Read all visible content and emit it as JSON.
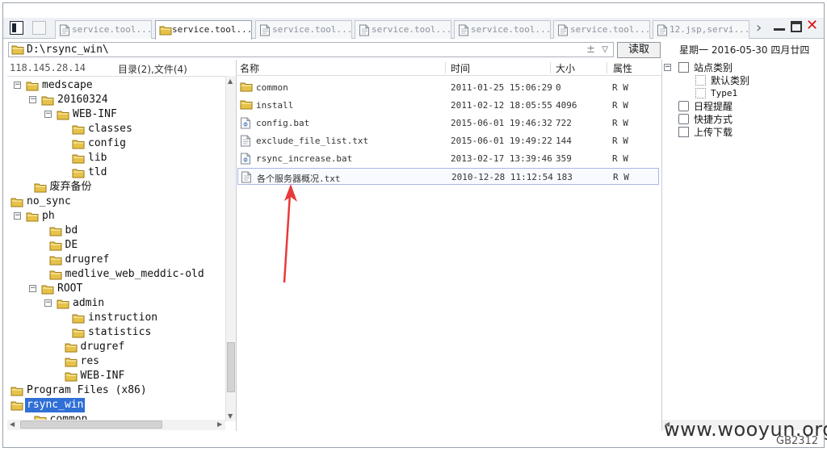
{
  "tabs": [
    {
      "label": "service.tool...",
      "active": false,
      "icon": "file-icon"
    },
    {
      "label": "service.tool...",
      "active": true,
      "icon": "folder-icon"
    },
    {
      "label": "service.tool...",
      "active": false,
      "icon": "file-icon"
    },
    {
      "label": "service.tool...",
      "active": false,
      "icon": "file-icon"
    },
    {
      "label": "service.tool...",
      "active": false,
      "icon": "file-icon"
    },
    {
      "label": "service.tool...",
      "active": false,
      "icon": "file-icon"
    },
    {
      "label": "12.jsp,servi...",
      "active": false,
      "icon": "file-icon"
    }
  ],
  "window_controls": {
    "close": "✕"
  },
  "address": {
    "path": "D:\\rsync_win\\",
    "plusminus": "±",
    "dropdown": "▽"
  },
  "read_button": "读取",
  "date": "星期一  2016-05-30  四月廿四",
  "left_header": {
    "ip": "118.145.28.14",
    "counts": "目录(2),文件(4)"
  },
  "tree": [
    {
      "label": "medscape",
      "toggle": "−",
      "depth": 0
    },
    {
      "label": "20160324",
      "toggle": "−",
      "depth": 1
    },
    {
      "label": "WEB-INF",
      "toggle": "−",
      "depth": 2
    },
    {
      "label": "classes",
      "toggle": "",
      "depth": 3
    },
    {
      "label": "config",
      "toggle": "",
      "depth": 3
    },
    {
      "label": "lib",
      "toggle": "",
      "depth": 3
    },
    {
      "label": "tld",
      "toggle": "",
      "depth": 3
    },
    {
      "label": "废弃备份",
      "toggle": "",
      "depth": 0.5
    },
    {
      "label": "no_sync",
      "toggle": "",
      "depth": -1
    },
    {
      "label": "ph",
      "toggle": "−",
      "depth": 0
    },
    {
      "label": "bd",
      "toggle": "",
      "depth": 1.5
    },
    {
      "label": "DE",
      "toggle": "",
      "depth": 1.5
    },
    {
      "label": "drugref",
      "toggle": "",
      "depth": 1.5
    },
    {
      "label": "medlive_web_meddic-old",
      "toggle": "",
      "depth": 1.5
    },
    {
      "label": "ROOT",
      "toggle": "−",
      "depth": 1
    },
    {
      "label": "admin",
      "toggle": "−",
      "depth": 2
    },
    {
      "label": "instruction",
      "toggle": "",
      "depth": 3
    },
    {
      "label": "statistics",
      "toggle": "",
      "depth": 3
    },
    {
      "label": "drugref",
      "toggle": "",
      "depth": 2.5
    },
    {
      "label": "res",
      "toggle": "",
      "depth": 2.5
    },
    {
      "label": "WEB-INF",
      "toggle": "",
      "depth": 2.5
    },
    {
      "label": "Program Files (x86)",
      "toggle": "",
      "depth": -1
    },
    {
      "label": "rsync_win",
      "toggle": "",
      "depth": -1,
      "selected": true
    },
    {
      "label": "common",
      "toggle": "",
      "depth": 0.5
    }
  ],
  "file_columns": {
    "name": "名称",
    "time": "时间",
    "size": "大小",
    "attr": "属性"
  },
  "files": [
    {
      "name": "common",
      "time": "2011-01-25 15:06:29",
      "size": "0",
      "attr": "R W",
      "icon": "folder-icon"
    },
    {
      "name": "install",
      "time": "2011-02-12 18:05:55",
      "size": "4096",
      "attr": "R W",
      "icon": "folder-icon"
    },
    {
      "name": "config.bat",
      "time": "2015-06-01 19:46:32",
      "size": "722",
      "attr": "R W",
      "icon": "batch-file-icon"
    },
    {
      "name": "exclude_file_list.txt",
      "time": "2015-06-01 19:49:22",
      "size": "144",
      "attr": "R W",
      "icon": "text-file-icon"
    },
    {
      "name": "rsync_increase.bat",
      "time": "2013-02-17 13:39:46",
      "size": "359",
      "attr": "R W",
      "icon": "batch-file-icon"
    },
    {
      "name": "各个服务器概况.txt",
      "time": "2010-12-28 11:12:54",
      "size": "183",
      "attr": "R W",
      "icon": "text-file-icon",
      "selected": true
    }
  ],
  "right_tree": {
    "site_category": "站点类别",
    "default_category": "默认类别",
    "type1": "Type1",
    "schedule": "日程提醒",
    "shortcut": "快捷方式",
    "upload_download": "上传下载"
  },
  "watermark": {
    "site": "www.wooyun.org",
    "encoding": "GB2312"
  },
  "colors": {
    "selection": "#2f6fd6",
    "folder": "#e7c24a",
    "arrow": "#e83a3a"
  }
}
